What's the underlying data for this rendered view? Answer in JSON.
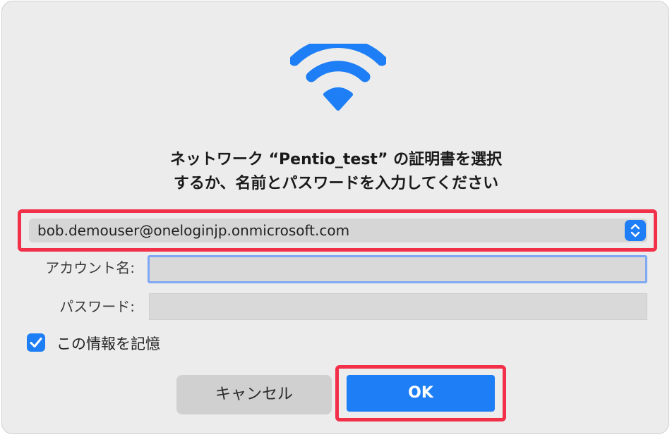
{
  "dialog": {
    "icon": "wifi-icon",
    "message_line1": "ネットワーク “Pentio_test” の証明書を選択",
    "message_line2": "するか、名前とパスワードを入力してください",
    "certificate_select": {
      "value": "bob.demouser@oneloginjp.onmicrosoft.com",
      "icon": "stepper-updown-icon"
    },
    "account": {
      "label": "アカウント名:",
      "value": ""
    },
    "password": {
      "label": "パスワード:",
      "value": ""
    },
    "remember": {
      "label": "この情報を記憶",
      "checked": true
    },
    "buttons": {
      "cancel": "キャンセル",
      "ok": "OK"
    },
    "colors": {
      "accent": "#1e7ef5",
      "highlight": "#f2304a",
      "background": "#ececec"
    }
  }
}
